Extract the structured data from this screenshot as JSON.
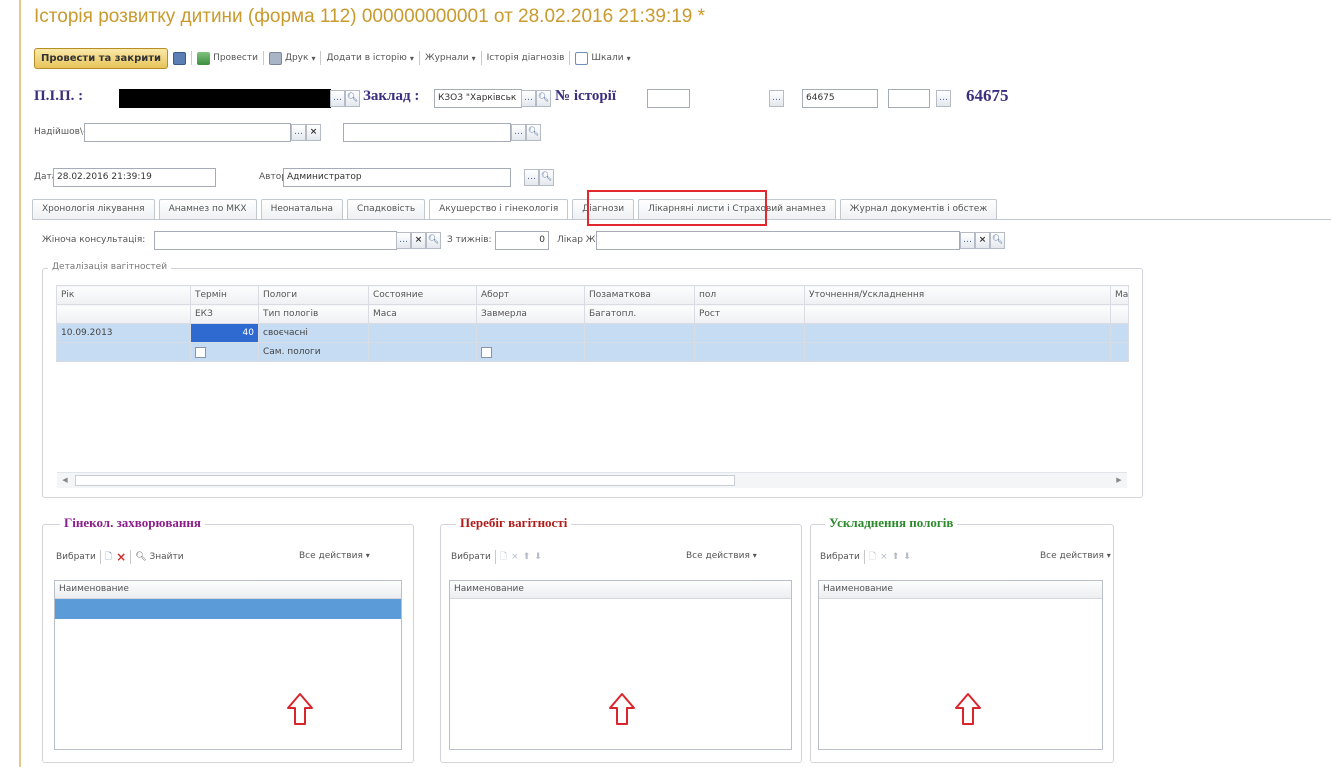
{
  "window": {
    "title": "Історія розвитку дитини (форма 112) 000000000001 от 28.02.2016 21:39:19 *"
  },
  "toolbar": {
    "post_close": "Провести та закрити",
    "post": "Провести",
    "print": "Друк",
    "add_history": "Додати в історію",
    "journals": "Журнали",
    "diag_history": "Історія діагнозів",
    "scales": "Шкали"
  },
  "header": {
    "pib_label": "П.І.П. :",
    "institution_label": "Заклад :",
    "institution_value": "КЗОЗ \"Харківськ",
    "history_label": "№ історії",
    "history_field": "64675",
    "history_number": "64675",
    "came_label": "Надійшов\\-ла:",
    "date_label": "Дата:",
    "date_value": "28.02.2016 21:39:19",
    "author_label": "Автор:",
    "author_value": "Администратор"
  },
  "tabs": [
    "Хронологія лікування",
    "Анамнез по МКХ",
    "Неонатальна",
    "Спадковість",
    "Акушерство і гінекологія",
    "Діагнози",
    "Лікарняні листи і Страховий анамнез",
    "Журнал документів і обстеж"
  ],
  "consult": {
    "label": "Жіноча консультація:",
    "weeks_label": "З тижнів:",
    "weeks_value": "0",
    "doctor_label": "Лікар ЖК:"
  },
  "pregnancy": {
    "title": "Деталізація вагітностей",
    "header1": [
      "Рік",
      "Термін",
      "Пологи",
      "Состояние",
      "Аборт",
      "Позаматкова",
      "пол",
      "Уточнення/Ускладнення",
      "Мас"
    ],
    "header2": [
      "",
      "ЕКЗ",
      "Тип пологів",
      "Маса",
      "Завмерла",
      "Багатопл.",
      "Рост",
      "",
      ""
    ],
    "row": {
      "year": "10.09.2013",
      "term": "40",
      "birth": "своєчасні",
      "birth_type": "Сам. пологи"
    }
  },
  "groups": {
    "gyn": {
      "title": "Гінекол. захворювання",
      "title_color": "#8b1d8b",
      "select": "Вибрати",
      "find": "Знайти",
      "all_actions": "Все действия",
      "column": "Наименование"
    },
    "preg_course": {
      "title": "Перебіг вагітності",
      "title_color": "#b01c1c",
      "select": "Вибрати",
      "all_actions": "Все действия",
      "column": "Наименование"
    },
    "birth_comp": {
      "title": "Ускладнення пологів",
      "title_color": "#2c8a2c",
      "select": "Вибрати",
      "all_actions": "Все действия",
      "column": "Наименование"
    }
  },
  "colors": {
    "title": "#c99a2e",
    "header_label": "#3b2f7f",
    "selection": "#c5dcf3",
    "highlight_box": "#e0282e"
  }
}
